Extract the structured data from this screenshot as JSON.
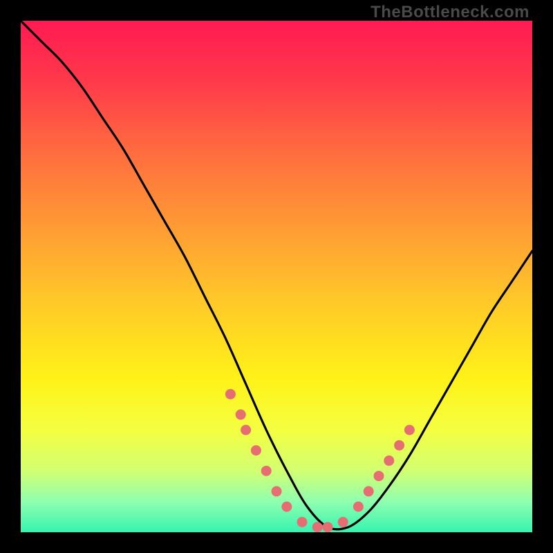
{
  "watermark": "TheBottleneck.com",
  "gradient": {
    "stops": [
      {
        "offset": 0.0,
        "color": "#ff1a52"
      },
      {
        "offset": 0.12,
        "color": "#ff3a4a"
      },
      {
        "offset": 0.25,
        "color": "#ff6a3f"
      },
      {
        "offset": 0.4,
        "color": "#ff9a34"
      },
      {
        "offset": 0.55,
        "color": "#ffc928"
      },
      {
        "offset": 0.7,
        "color": "#fff218"
      },
      {
        "offset": 0.8,
        "color": "#f4ff40"
      },
      {
        "offset": 0.88,
        "color": "#d2ff72"
      },
      {
        "offset": 0.94,
        "color": "#8fffb0"
      },
      {
        "offset": 1.0,
        "color": "#36f4b0"
      }
    ]
  },
  "chart_data": {
    "type": "line",
    "title": "",
    "xlabel": "",
    "ylabel": "",
    "xlim": [
      0,
      100
    ],
    "ylim": [
      0,
      100
    ],
    "grid": false,
    "legend": false,
    "series": [
      {
        "name": "bottleneck-curve",
        "x": [
          0,
          4,
          8,
          12,
          16,
          20,
          24,
          28,
          32,
          36,
          40,
          44,
          48,
          52,
          56,
          60,
          64,
          68,
          72,
          76,
          80,
          84,
          88,
          92,
          96,
          100
        ],
        "y": [
          100,
          96,
          92,
          87,
          81,
          75,
          68,
          61,
          54,
          46,
          38,
          29,
          20,
          12,
          5,
          1,
          1,
          4,
          9,
          15,
          22,
          29,
          36,
          43,
          49,
          55
        ]
      }
    ],
    "highlight_points": {
      "name": "highlight-dots",
      "x": [
        41,
        43,
        44,
        46,
        48,
        50,
        52,
        55,
        58,
        60,
        63,
        66,
        68,
        70,
        72,
        74,
        76
      ],
      "y": [
        27,
        23,
        20,
        16,
        12,
        8,
        5,
        2,
        1,
        1,
        2,
        5,
        8,
        11,
        14,
        17,
        20
      ]
    }
  }
}
